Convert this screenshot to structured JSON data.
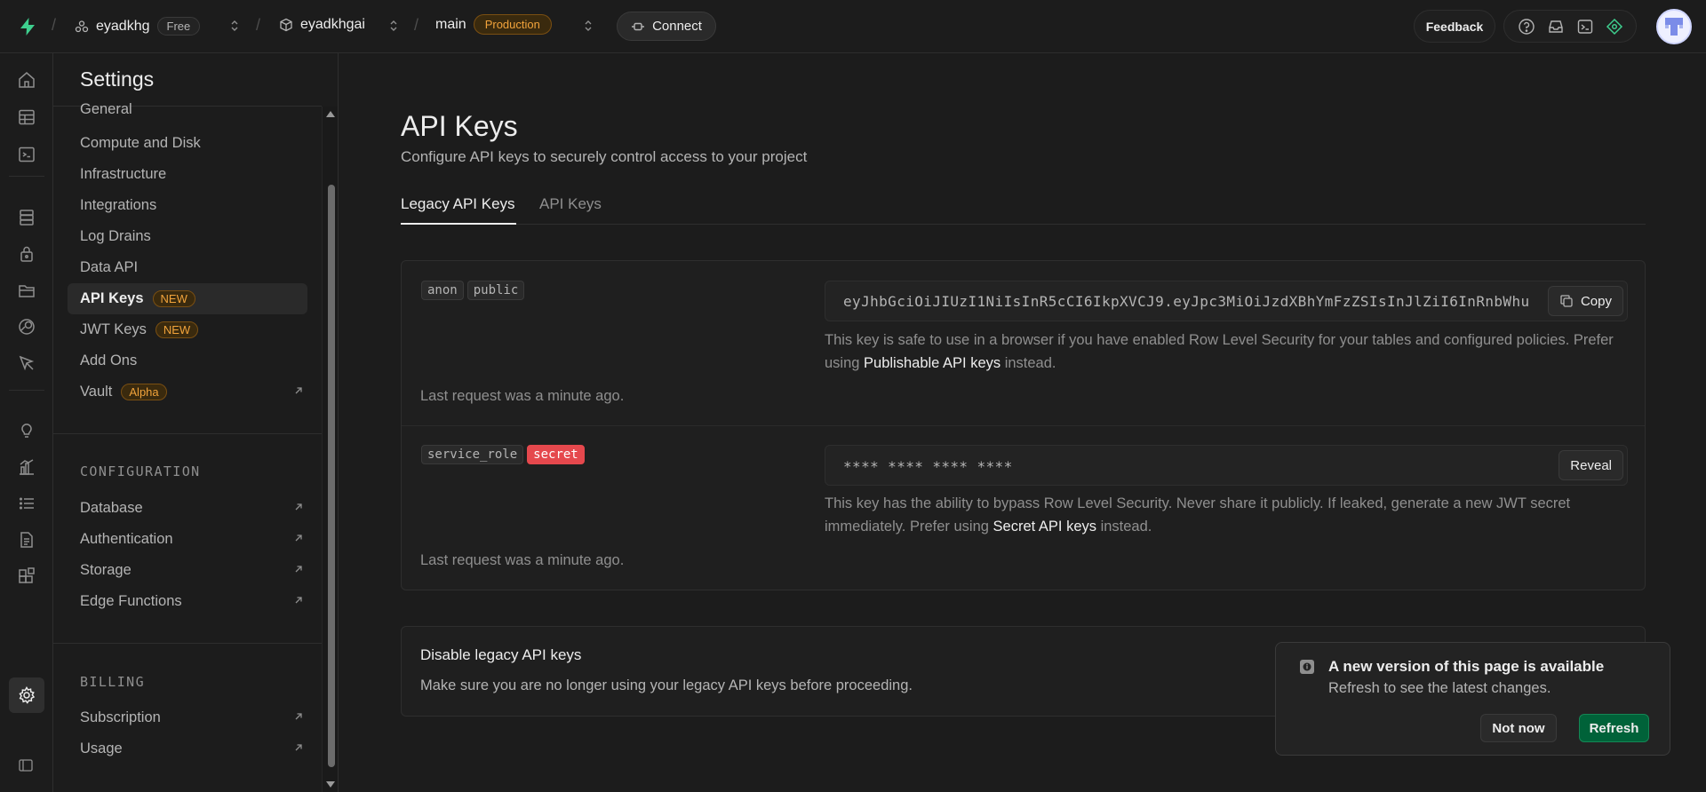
{
  "topbar": {
    "org_name": "eyadkhg",
    "org_plan": "Free",
    "project_name": "eyadkhgai",
    "branch_name": "main",
    "branch_env": "Production",
    "connect_label": "Connect",
    "feedback_label": "Feedback"
  },
  "sidebar": {
    "title": "Settings",
    "items": [
      {
        "label": "General"
      },
      {
        "label": "Compute and Disk"
      },
      {
        "label": "Infrastructure"
      },
      {
        "label": "Integrations"
      },
      {
        "label": "Log Drains"
      },
      {
        "label": "Data API"
      },
      {
        "label": "API Keys",
        "badge": "NEW",
        "active": true
      },
      {
        "label": "JWT Keys",
        "badge": "NEW"
      },
      {
        "label": "Add Ons"
      },
      {
        "label": "Vault",
        "badge": "Alpha"
      }
    ],
    "configuration_heading": "CONFIGURATION",
    "configuration_items": [
      {
        "label": "Database"
      },
      {
        "label": "Authentication"
      },
      {
        "label": "Storage"
      },
      {
        "label": "Edge Functions"
      }
    ],
    "billing_heading": "BILLING",
    "billing_items": [
      {
        "label": "Subscription"
      },
      {
        "label": "Usage"
      }
    ]
  },
  "main": {
    "title": "API Keys",
    "subtitle": "Configure API keys to securely control access to your project",
    "tabs": [
      {
        "label": "Legacy API Keys",
        "active": true
      },
      {
        "label": "API Keys"
      }
    ],
    "keys": [
      {
        "tags": [
          "anon",
          "public"
        ],
        "value": "eyJhbGciOiJIUzI1NiIsInR5cCI6IkpXVCJ9.eyJpc3MiOiJzdXBhYmFzZSIsInJlZiI6InRnbWhu",
        "button": "Copy",
        "desc_pre": "This key is safe to use in a browser if you have enabled Row Level Security for your tables and configured policies. Prefer using ",
        "desc_link": "Publishable API keys",
        "desc_post": " instead.",
        "last_request": "Last request was a minute ago."
      },
      {
        "tags": [
          "service_role",
          "secret"
        ],
        "value": "**** **** **** ****",
        "button": "Reveal",
        "desc_pre": "This key has the ability to bypass Row Level Security. Never share it publicly. If leaked, generate a new JWT secret immediately. Prefer using ",
        "desc_link": "Secret API keys",
        "desc_post": " instead.",
        "last_request": "Last request was a minute ago."
      }
    ],
    "disable": {
      "title": "Disable legacy API keys",
      "subtitle": "Make sure you are no longer using your legacy API keys before proceeding."
    }
  },
  "toast": {
    "title": "A new version of this page is available",
    "subtitle": "Refresh to see the latest changes.",
    "not_now": "Not now",
    "refresh": "Refresh"
  },
  "colors": {
    "brand": "#3ecf8e",
    "warning": "#f1a33b",
    "danger": "#e5484d",
    "refresh_button": "#006239"
  }
}
